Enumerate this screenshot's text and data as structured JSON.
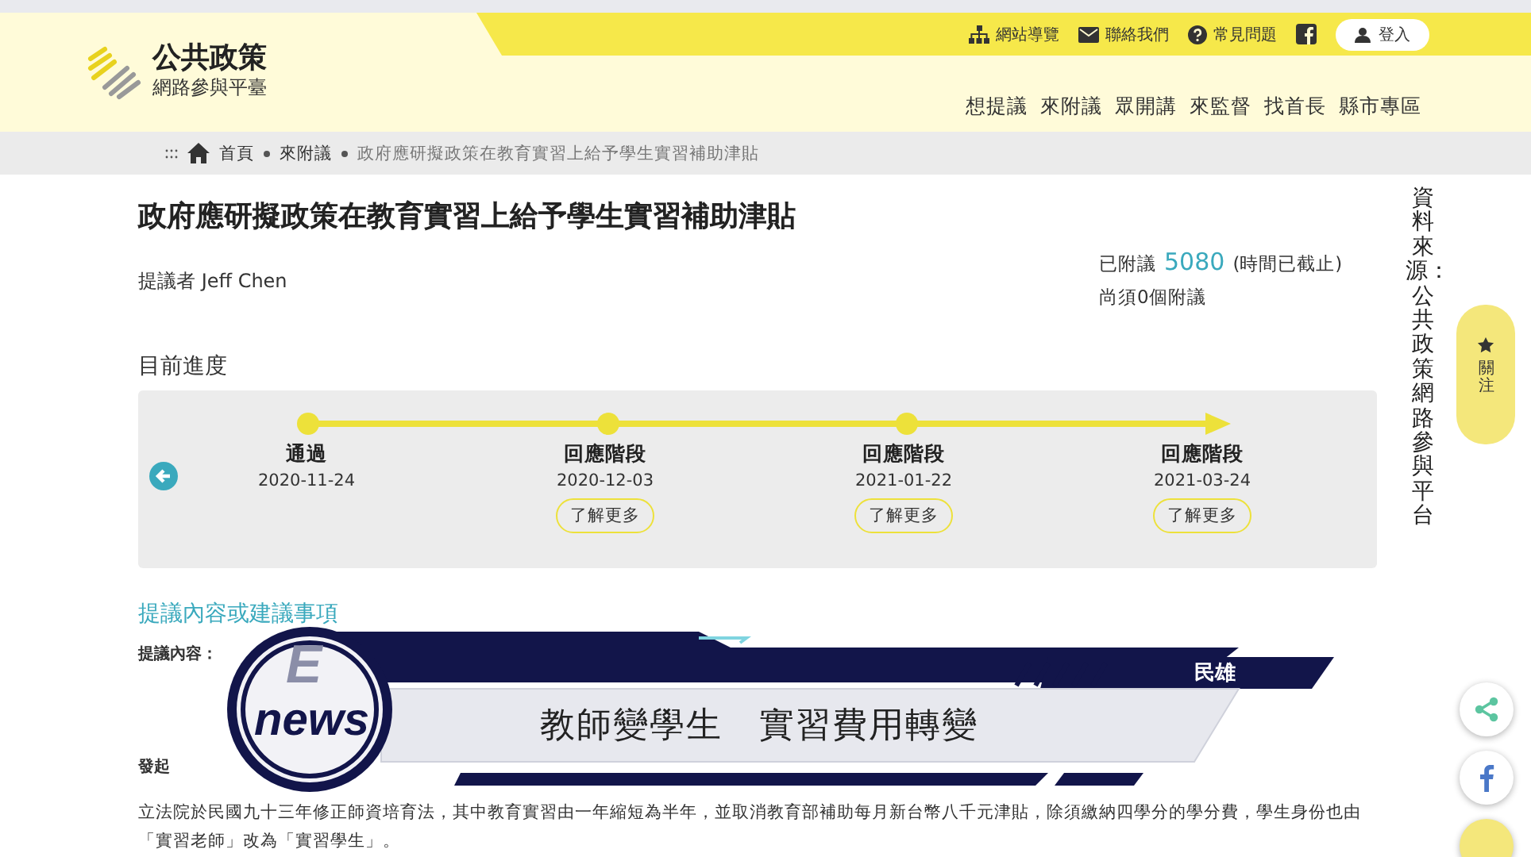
{
  "header": {
    "logo": {
      "title": "公共政策",
      "subtitle": "網路參與平臺"
    },
    "utility_links": [
      {
        "kind": "sitemap",
        "label": "網站導覽"
      },
      {
        "kind": "mail",
        "label": "聯絡我們"
      },
      {
        "kind": "help",
        "label": "常見問題"
      },
      {
        "kind": "facebook"
      }
    ],
    "login_button": "登入",
    "nav": [
      "想提議",
      "來附議",
      "眾開講",
      "來監督",
      "找首長",
      "縣市專區"
    ]
  },
  "breadcrumb": {
    "items": [
      "首頁",
      "來附議",
      "政府應研擬政策在教育實習上給予學生實習補助津貼"
    ]
  },
  "proposal": {
    "title": "政府應研擬政策在教育實習上給予學生實習補助津貼",
    "proposer": "提議者 Jeff Chen",
    "seconded_label": "已附議",
    "seconded_count": "5080",
    "status": "(時間已截止)",
    "remaining": "尚須0個附議"
  },
  "progress": {
    "heading": "目前進度",
    "stages": [
      {
        "name": "通過",
        "date": "2020-11-24"
      },
      {
        "name": "回應階段",
        "date": "2020-12-03",
        "more_button": "了解更多"
      },
      {
        "name": "回應階段",
        "date": "2021-01-22",
        "more_button": "了解更多"
      },
      {
        "name": "回應階段",
        "date": "2021-03-24",
        "more_button": "了解更多"
      }
    ]
  },
  "content": {
    "heading": "提議內容或建議事項",
    "label": "提議內容：",
    "section_label": "發起",
    "paragraph": "立法院於民國九十三年修正師資培育法，其中教育實習由一年縮短為半年，並取消教育部補助每月新台幣八千元津貼，除須繳納四學分的學分費，學生身份也由「實習老師」改為「實習學生」。"
  },
  "side": {
    "source_caption": "資料來源：公共政策網路參與平台",
    "follow_button": "關注"
  },
  "news_banner": {
    "logo_letter": "E",
    "logo_word": "news",
    "location_tag": "民雄",
    "headline": "教師變學生　實習費用轉變"
  }
}
